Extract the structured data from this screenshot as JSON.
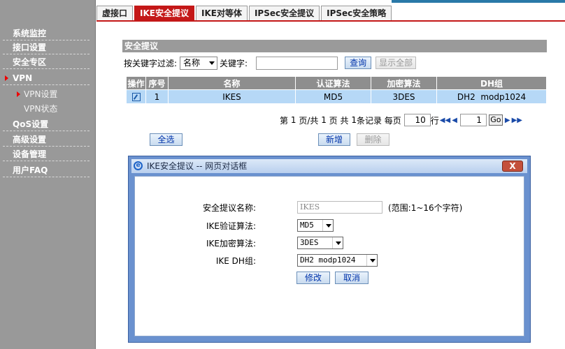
{
  "sidebar": {
    "items": [
      {
        "label": "系统监控"
      },
      {
        "label": "接口设置"
      },
      {
        "label": "安全专区"
      },
      {
        "label": "VPN"
      },
      {
        "label": "VPN设置"
      },
      {
        "label": "VPN状态"
      },
      {
        "label": "QoS设置"
      },
      {
        "label": "高级设置"
      },
      {
        "label": "设备管理"
      },
      {
        "label": "用户FAQ"
      }
    ]
  },
  "tabs": [
    {
      "label": "虚接口"
    },
    {
      "label": "IKE安全提议"
    },
    {
      "label": "IKE对等体"
    },
    {
      "label": "IPSec安全提议"
    },
    {
      "label": "IPSec安全策略"
    }
  ],
  "section": {
    "title": "安全提议",
    "filter_label": "按关键字过滤:",
    "filter_select": "名称",
    "keyword_label": "关键字:",
    "keyword_value": "",
    "query_button": "查询",
    "show_all_button": "显示全部"
  },
  "table": {
    "headers": [
      "操作",
      "序号",
      "名称",
      "认证算法",
      "加密算法",
      "DH组"
    ],
    "rows": [
      {
        "index": "1",
        "name": "IKES",
        "auth": "MD5",
        "enc": "3DES",
        "dh": "DH2  modp1024"
      }
    ]
  },
  "pager": {
    "page_prefix": "第",
    "current_page": "1",
    "page_mid": "页/共",
    "total_pages": "1",
    "total_suffix": "页 共",
    "record_count": "1",
    "record_suffix": "条记录 每页",
    "per_page": "10",
    "per_page_suffix": "行",
    "goto_page": "1",
    "go_label": "Go"
  },
  "actions": {
    "select_all": "全选",
    "add": "新增",
    "delete": "删除"
  },
  "dialog": {
    "title": "IKE安全提议 -- 网页对话框",
    "close_label": "X",
    "name_label": "安全提议名称:",
    "name_value": "IKES",
    "name_hint": "(范围:1~16个字符)",
    "auth_label": "IKE验证算法:",
    "auth_value": "MD5",
    "enc_label": "IKE加密算法:",
    "enc_value": "3DES",
    "dh_label": "IKE DH组:",
    "dh_value": "DH2 modp1024",
    "modify_button": "修改",
    "cancel_button": "取消"
  }
}
